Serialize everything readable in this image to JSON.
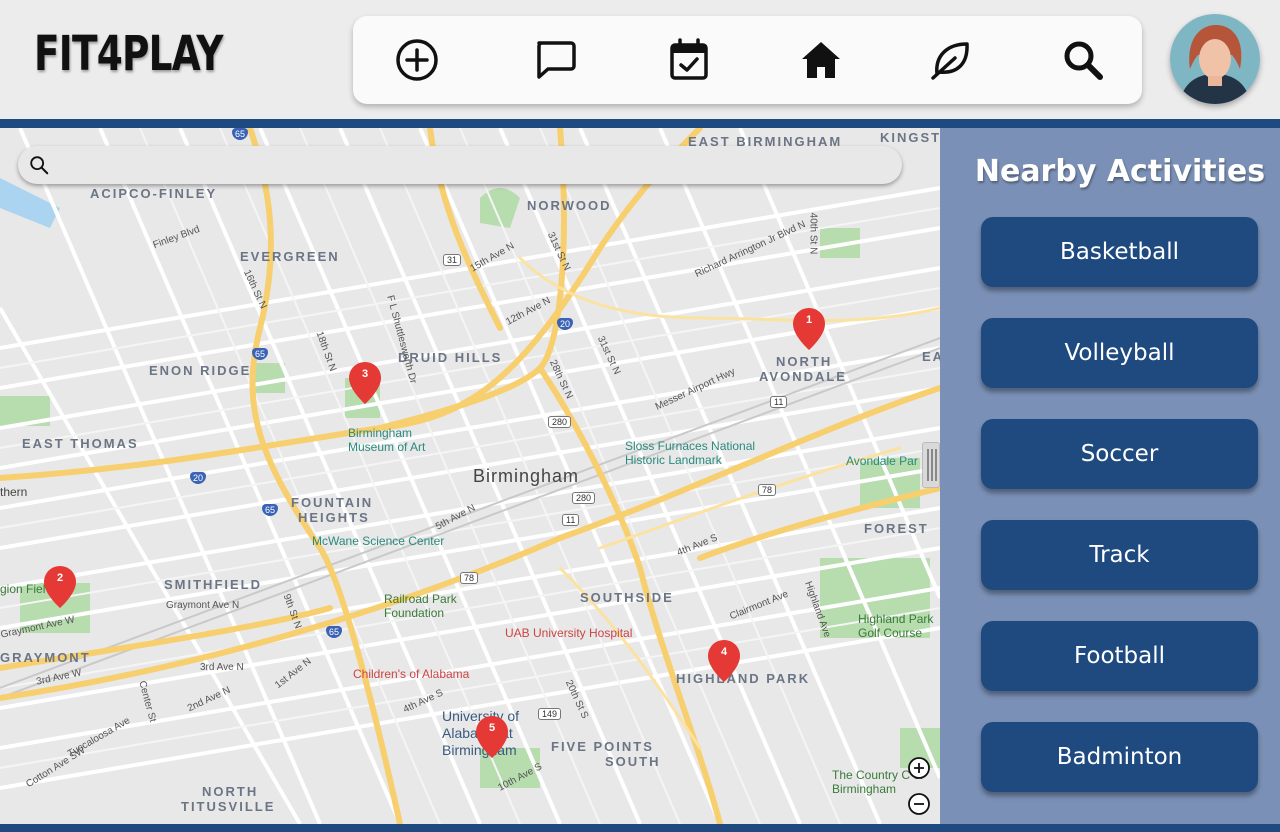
{
  "app": {
    "logo": "FIT4PLAY"
  },
  "toolbar": {
    "items": [
      {
        "name": "add",
        "icon": "plus-circle-icon"
      },
      {
        "name": "messages",
        "icon": "chat-bubble-icon"
      },
      {
        "name": "calendar",
        "icon": "calendar-check-icon"
      },
      {
        "name": "home",
        "icon": "home-icon"
      },
      {
        "name": "leaf",
        "icon": "leaf-icon"
      },
      {
        "name": "search",
        "icon": "search-icon"
      }
    ]
  },
  "user": {
    "avatar_icon": "user-avatar"
  },
  "map": {
    "search_placeholder": "",
    "city": "Birmingham",
    "districts": [
      "EAST BIRMINGHAM",
      "KINGST",
      "ACIPCO-FINLEY",
      "NORWOOD",
      "EVERGREEN",
      "DRUID HILLS",
      "NORTH",
      "AVONDALE",
      "ENON RIDGE",
      "EAST THOMAS",
      "FOUNTAIN",
      "HEIGHTS",
      "SMITHFIELD",
      "SOUTHSIDE",
      "FOREST",
      "GRAYMONT",
      "HIGHLAND PARK",
      "FIVE POINTS",
      "SOUTH",
      "NORTH",
      "TITUSVILLE",
      "EA"
    ],
    "streets": [
      "Finley Blvd",
      "15th Ave N",
      "31st St N",
      "Richard Arrington Jr Blvd N",
      "40th St N",
      "16th St N",
      "12th Ave N",
      "F L Shuttlesworth Dr",
      "18th St N",
      "31st St N",
      "28th St N",
      "Messer Airport Hwy",
      "5th Ave N",
      "4th Ave S",
      "Graymont Ave N",
      "Graymont Ave W",
      "9th St N",
      "3rd Ave N",
      "1st Ave N",
      "3rd Ave W",
      "2nd Ave N",
      "Center St",
      "Tuscaloosa Ave",
      "Cotton Ave SW",
      "4th Ave S",
      "20th St S",
      "10th Ave S",
      "Clairmont Ave",
      "Highland Ave"
    ],
    "pois": [
      "Birmingham Museum of Art",
      "Sloss Furnaces National Historic Landmark",
      "Avondale Par",
      "McWane Science Center",
      "Railroad Park Foundation",
      "UAB University Hospital",
      "Children's of Alabama",
      "University of Alabama at Birmingham",
      "Highland Park Golf Course",
      "The Country C of Birmingham",
      "gion Fiel",
      "thern"
    ],
    "route_shields": [
      "65",
      "31",
      "20",
      "65",
      "280",
      "20",
      "65",
      "280",
      "11",
      "11",
      "78",
      "78",
      "65",
      "149"
    ],
    "pins": [
      {
        "label": "1"
      },
      {
        "label": "2"
      },
      {
        "label": "3"
      },
      {
        "label": "4"
      },
      {
        "label": "5"
      }
    ],
    "zoom_in_icon": "zoom-in-icon",
    "zoom_out_icon": "zoom-out-icon"
  },
  "panel": {
    "title": "Nearby Activities",
    "activities": [
      "Basketball",
      "Volleyball",
      "Soccer",
      "Track",
      "Football",
      "Badminton"
    ]
  },
  "colors": {
    "brand": "#1f4a80",
    "panel": "#7a90b6",
    "pin": "#e53935",
    "header": "#ececec"
  }
}
